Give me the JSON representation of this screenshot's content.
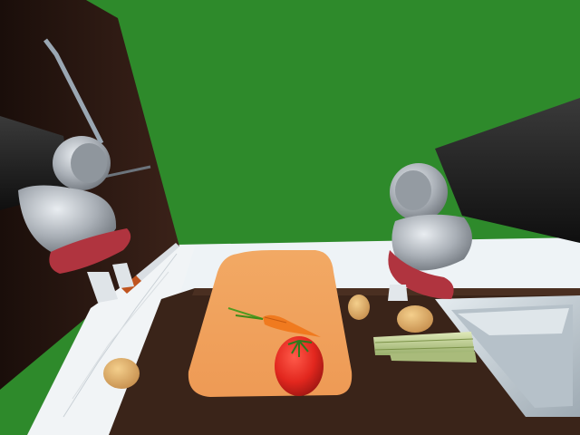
{
  "scene": {
    "kind": "3d-kitchen-simulation",
    "colors": {
      "sky": "#2e8a2b",
      "cabinet": "#2a1712",
      "countertop": "#3a2419",
      "cutting_board": "#f0a35c",
      "sink": "#c9d2d8",
      "wall_trim": "#eef3f6",
      "robot_arm": "#1a1a1a",
      "gripper_body": "#b9bdc2",
      "gripper_pad": "#b0343f"
    },
    "objects": [
      {
        "name": "left-robot-arm",
        "icon": "robot-gripper-icon"
      },
      {
        "name": "right-robot-arm",
        "icon": "robot-gripper-icon"
      },
      {
        "name": "knife",
        "icon": "knife-icon"
      },
      {
        "name": "cutting-board",
        "icon": "cutting-board-icon"
      },
      {
        "name": "carrot",
        "icon": "carrot-icon"
      },
      {
        "name": "tomato",
        "icon": "tomato-icon"
      },
      {
        "name": "potato-left",
        "icon": "potato-icon"
      },
      {
        "name": "potato-back",
        "icon": "potato-icon"
      },
      {
        "name": "potato-right",
        "icon": "potato-icon"
      },
      {
        "name": "celery",
        "icon": "celery-icon"
      },
      {
        "name": "sink",
        "icon": "sink-icon"
      }
    ]
  }
}
